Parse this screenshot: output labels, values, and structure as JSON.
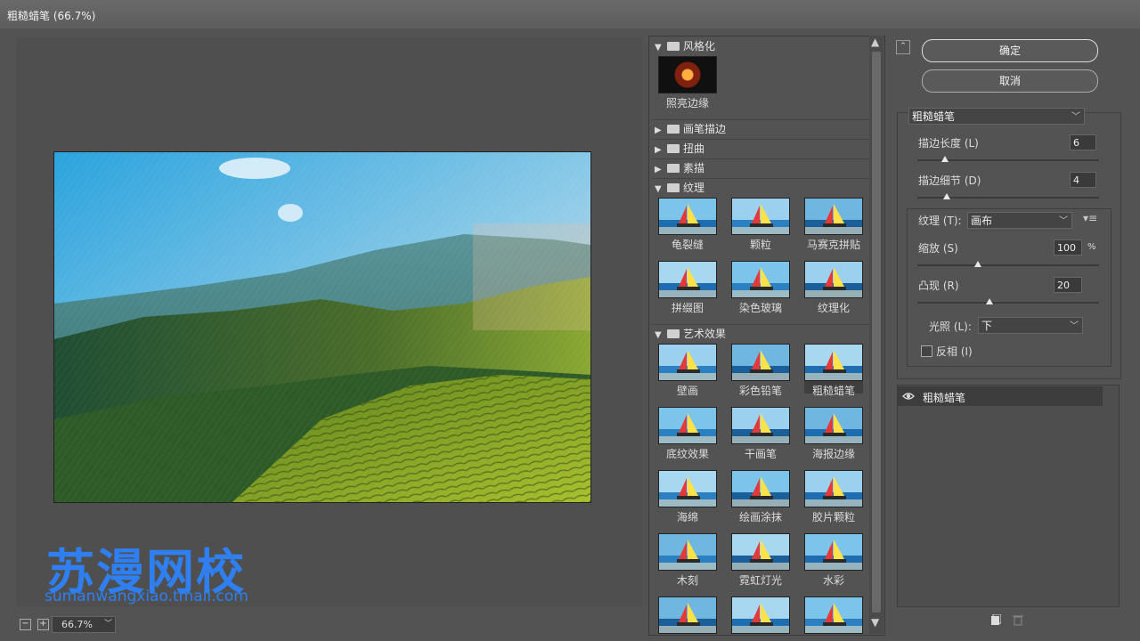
{
  "window": {
    "title": "粗糙蜡笔 (66.7%)"
  },
  "preview": {
    "zoom": "66.7%",
    "zoom_out": "−",
    "zoom_in": "+"
  },
  "watermark": {
    "brand": "苏漫网校",
    "url": "sumanwangxiao.tmall.com"
  },
  "gallery": {
    "categories": {
      "stylize": {
        "label": "风格化",
        "expanded": true
      },
      "brush": {
        "label": "画笔描边",
        "expanded": false
      },
      "distort": {
        "label": "扭曲",
        "expanded": false
      },
      "sketch": {
        "label": "素描",
        "expanded": false
      },
      "texture": {
        "label": "纹理",
        "expanded": true
      },
      "artistic": {
        "label": "艺术效果",
        "expanded": true
      }
    },
    "stylize_items": [
      "照亮边缘"
    ],
    "texture_items": [
      "龟裂缝",
      "颗粒",
      "马赛克拼贴",
      "拼缀图",
      "染色玻璃",
      "纹理化"
    ],
    "artistic_items": [
      "壁画",
      "彩色铅笔",
      "粗糙蜡笔",
      "底纹效果",
      "干画笔",
      "海报边缘",
      "海绵",
      "绘画涂抹",
      "胶片颗粒",
      "木刻",
      "霓虹灯光",
      "水彩"
    ],
    "selected": "粗糙蜡笔"
  },
  "buttons": {
    "ok": "确定",
    "cancel": "取消"
  },
  "settings": {
    "filter": "粗糙蜡笔",
    "stroke_length": {
      "label": "描边长度 (L)",
      "value": "6"
    },
    "stroke_detail": {
      "label": "描边细节 (D)",
      "value": "4"
    },
    "texture": {
      "label": "纹理 (T):",
      "value": "画布"
    },
    "scaling": {
      "label": "缩放 (S)",
      "value": "100",
      "unit": "%"
    },
    "relief": {
      "label": "凸现 (R)",
      "value": "20"
    },
    "light": {
      "label": "光照 (L):",
      "value": "下"
    },
    "invert": {
      "label": "反相 (I)",
      "checked": false
    }
  },
  "layers": {
    "items": [
      "粗糙蜡笔"
    ]
  },
  "colors": {
    "accent": "#2f7ff0",
    "panel": "#535353"
  }
}
